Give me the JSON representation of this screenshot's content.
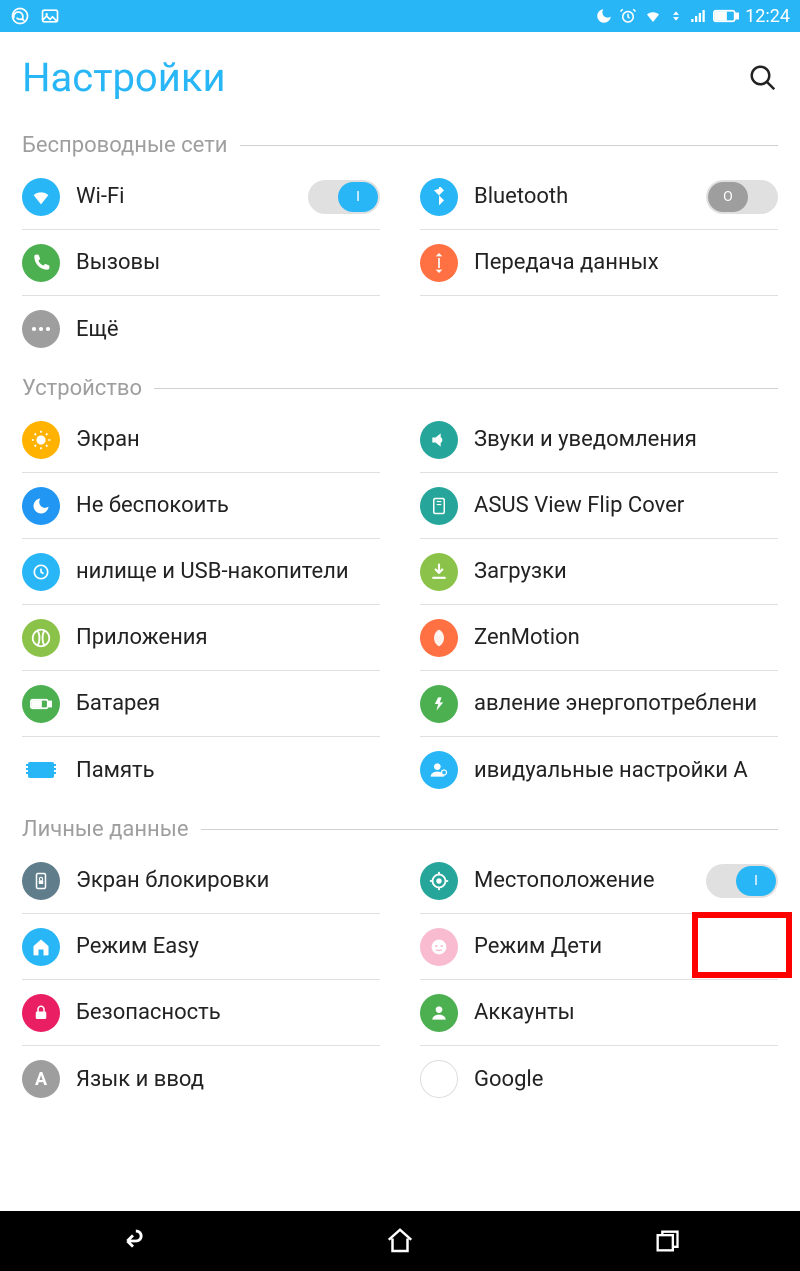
{
  "status": {
    "time": "12:24"
  },
  "header": {
    "title": "Настройки"
  },
  "sections": {
    "wireless": {
      "title": "Беспроводные сети"
    },
    "device": {
      "title": "Устройство"
    },
    "personal": {
      "title": "Личные данные"
    }
  },
  "items": {
    "wifi": {
      "label": "Wi-Fi"
    },
    "bluetooth": {
      "label": "Bluetooth"
    },
    "calls": {
      "label": "Вызовы"
    },
    "data": {
      "label": "Передача данных"
    },
    "more": {
      "label": "Ещё"
    },
    "display": {
      "label": "Экран"
    },
    "sound": {
      "label": "Звуки и уведомления"
    },
    "dnd": {
      "label": "Не беспокоить"
    },
    "flipcover": {
      "label": "ASUS View Flip Cover"
    },
    "storage": {
      "label": "нилище и USB-накопители"
    },
    "downloads": {
      "label": "Загрузки"
    },
    "apps": {
      "label": "Приложения"
    },
    "zenmotion": {
      "label": "ZenMotion"
    },
    "battery": {
      "label": "Батарея"
    },
    "power": {
      "label": "авление энергопотреблени"
    },
    "memory": {
      "label": "Память"
    },
    "asuscust": {
      "label": "ивидуальные настройки A"
    },
    "lockscreen": {
      "label": "Экран блокировки"
    },
    "location": {
      "label": "Местоположение"
    },
    "easy": {
      "label": "Режим Easy"
    },
    "kids": {
      "label": "Режим Дети"
    },
    "security": {
      "label": "Безопасность"
    },
    "accounts": {
      "label": "Аккаунты"
    },
    "language": {
      "label": "Язык и ввод"
    },
    "google": {
      "label": "Google"
    }
  },
  "toggles": {
    "wifi": "I",
    "bluetooth": "O",
    "location": "I"
  }
}
